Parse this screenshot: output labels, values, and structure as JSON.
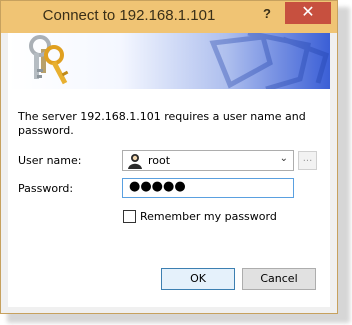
{
  "window": {
    "title": "Connect to 192.168.1.101",
    "help_label": "?",
    "close_label": "✕"
  },
  "message": "The server 192.168.1.101 requires a user name and password.",
  "form": {
    "username_label": "User name:",
    "username_value": "root",
    "browse_label": "...",
    "password_label": "Password:",
    "password_value": "●●●●●",
    "remember_label": "Remember my password",
    "remember_checked": false
  },
  "buttons": {
    "ok": "OK",
    "cancel": "Cancel"
  },
  "icons": {
    "banner": "keys-icon",
    "user": "user-icon",
    "dropdown": "chevron-down-icon"
  },
  "colors": {
    "titlebar": "#f0c474",
    "close": "#c7503f",
    "focus": "#5aa0e0"
  }
}
